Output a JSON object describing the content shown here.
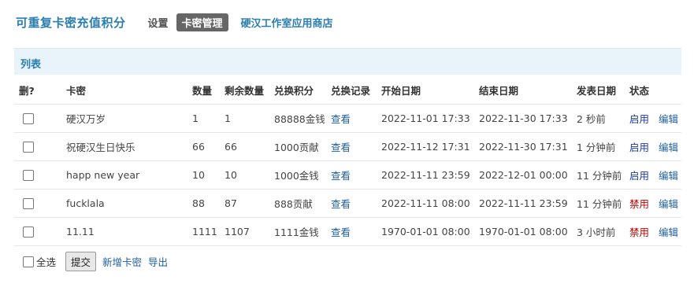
{
  "header": {
    "app_title": "可重复卡密充值积分",
    "nav": [
      {
        "label": "设置"
      },
      {
        "label": "卡密管理"
      },
      {
        "label": "硬汉工作室应用商店"
      }
    ]
  },
  "panel": {
    "title": "列表"
  },
  "table": {
    "columns": [
      "删?",
      "卡密",
      "数量",
      "剩余数量",
      "兑换积分",
      "兑换记录",
      "开始日期",
      "结束日期",
      "发表日期",
      "状态"
    ],
    "rows": [
      {
        "code": "硬汉万岁",
        "qty": "1",
        "remain": "1",
        "points": "88888金钱",
        "record": "查看",
        "start": "2022-11-01 17:33",
        "end": "2022-11-30 17:33",
        "posted": "2 秒前",
        "status": "启用",
        "edit": "编辑"
      },
      {
        "code": "祝硬汉生日快乐",
        "qty": "66",
        "remain": "66",
        "points": "1000贡献",
        "record": "查看",
        "start": "2022-11-12 17:31",
        "end": "2022-11-30 17:31",
        "posted": "1 分钟前",
        "status": "启用",
        "edit": "编辑"
      },
      {
        "code": "happ new year",
        "qty": "10",
        "remain": "10",
        "points": "1000金钱",
        "record": "查看",
        "start": "2022-11-11 23:59",
        "end": "2022-12-01 00:00",
        "posted": "11 分钟前",
        "status": "启用",
        "edit": "编辑"
      },
      {
        "code": "fucklala",
        "qty": "88",
        "remain": "87",
        "points": "888贡献",
        "record": "查看",
        "start": "2022-11-11 08:00",
        "end": "2022-11-11 23:59",
        "posted": "11 分钟前",
        "status": "禁用",
        "edit": "编辑"
      },
      {
        "code": "11.11",
        "qty": "1111",
        "remain": "1107",
        "points": "1111金钱",
        "record": "查看",
        "start": "1970-01-01 08:00",
        "end": "1970-01-01 08:00",
        "posted": "3 小时前",
        "status": "禁用",
        "edit": "编辑"
      }
    ]
  },
  "footer": {
    "select_all": "全选",
    "submit": "提交",
    "add_card": "新增卡密",
    "export": "导出"
  },
  "colors": {
    "accent": "#2b7fb0",
    "enabled": "#1a3aa8",
    "disabled": "#c00000",
    "panel_bg": "#e9f3fa"
  }
}
